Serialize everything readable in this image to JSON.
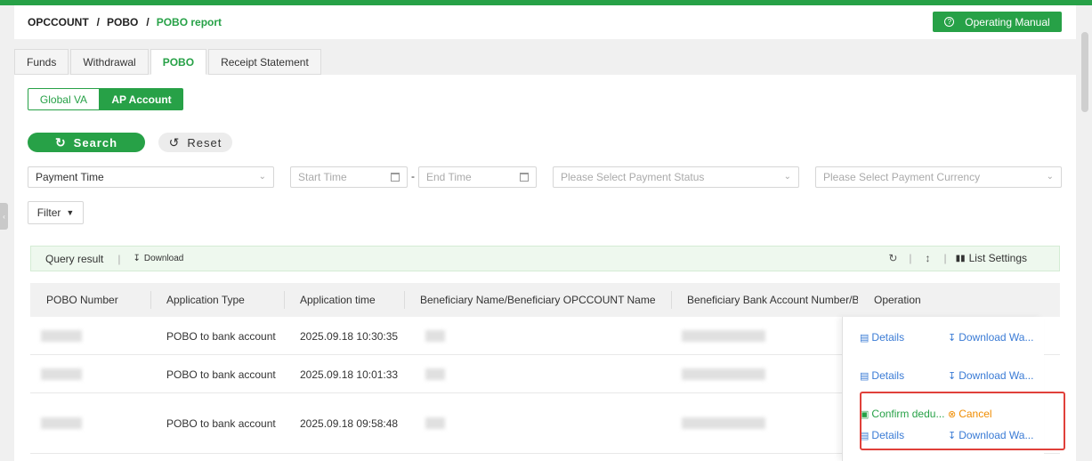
{
  "breadcrumb": {
    "items": [
      "OPCCOUNT",
      "POBO"
    ],
    "separator": "/",
    "current": "POBO report"
  },
  "header": {
    "manual_button": "Operating Manual"
  },
  "tabs": [
    "Funds",
    "Withdrawal",
    "POBO",
    "Receipt Statement"
  ],
  "active_tab": "POBO",
  "segment": {
    "options": [
      "Global VA",
      "AP Account"
    ],
    "selected": "AP Account"
  },
  "actions": {
    "search": "Search",
    "reset": "Reset"
  },
  "filters": {
    "time_type": "Payment Time",
    "start_placeholder": "Start Time",
    "range_sep": "-",
    "end_placeholder": "End Time",
    "status_placeholder": "Please Select Payment Status",
    "currency_placeholder": "Please Select Payment Currency",
    "filter_button": "Filter"
  },
  "query_bar": {
    "title": "Query result",
    "download": "Download",
    "list_settings": "List Settings"
  },
  "table": {
    "columns": [
      "POBO Number",
      "Application Type",
      "Application time",
      "Beneficiary Name/Beneficiary OPCCOUNT Name",
      "Beneficiary Bank Account Number/Ben",
      "Operation"
    ],
    "rows": [
      {
        "type": "POBO to bank account",
        "time": "2025.09.18 10:30:35",
        "ops": [
          "Details",
          "Download Wa..."
        ]
      },
      {
        "type": "POBO to bank account",
        "time": "2025.09.18 10:01:33",
        "ops": [
          "Details",
          "Download Wa..."
        ]
      },
      {
        "type": "POBO to bank account",
        "time": "2025.09.18 09:58:48",
        "ops": [
          "Confirm dedu...",
          "Cancel",
          "Details",
          "Download Wa..."
        ]
      }
    ]
  },
  "colors": {
    "brand": "#27a147",
    "link": "#3a7bd5",
    "cancel": "#f08c00",
    "highlight": "#e0403a"
  }
}
